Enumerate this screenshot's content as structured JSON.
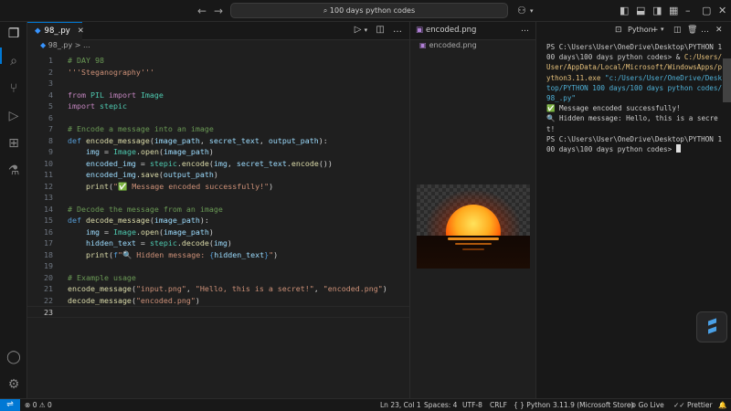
{
  "titlebar": {
    "search_text": "100 days python codes",
    "search_icon": "search-icon"
  },
  "editor": {
    "tab_label": "98_.py",
    "breadcrumb": "98_.py > ...",
    "lines": [
      {
        "n": "1",
        "segs": [
          [
            "cm",
            "# DAY 98"
          ]
        ]
      },
      {
        "n": "2",
        "segs": [
          [
            "st",
            "'''Steganography'''"
          ]
        ]
      },
      {
        "n": "3",
        "segs": []
      },
      {
        "n": "4",
        "segs": [
          [
            "kw",
            "from "
          ],
          [
            "ty",
            "PIL "
          ],
          [
            "kw",
            "import "
          ],
          [
            "ty",
            "Image"
          ]
        ]
      },
      {
        "n": "5",
        "segs": [
          [
            "kw",
            "import "
          ],
          [
            "ty",
            "stepic"
          ]
        ]
      },
      {
        "n": "6",
        "segs": []
      },
      {
        "n": "7",
        "segs": [
          [
            "cm",
            "# Encode a message into an image"
          ]
        ]
      },
      {
        "n": "8",
        "segs": [
          [
            "dk",
            "def "
          ],
          [
            "fn",
            "encode_message"
          ],
          [
            "pl",
            "("
          ],
          [
            "va",
            "image_path"
          ],
          [
            "pl",
            ", "
          ],
          [
            "va",
            "secret_text"
          ],
          [
            "pl",
            ", "
          ],
          [
            "va",
            "output_path"
          ],
          [
            "pl",
            "):"
          ]
        ]
      },
      {
        "n": "9",
        "segs": [
          [
            "pl",
            "    "
          ],
          [
            "va",
            "img"
          ],
          [
            "pl",
            " = "
          ],
          [
            "ty",
            "Image"
          ],
          [
            "pl",
            "."
          ],
          [
            "fn",
            "open"
          ],
          [
            "pl",
            "("
          ],
          [
            "va",
            "image_path"
          ],
          [
            "pl",
            ")"
          ]
        ]
      },
      {
        "n": "10",
        "segs": [
          [
            "pl",
            "    "
          ],
          [
            "va",
            "encoded_img"
          ],
          [
            "pl",
            " = "
          ],
          [
            "ty",
            "stepic"
          ],
          [
            "pl",
            "."
          ],
          [
            "fn",
            "encode"
          ],
          [
            "pl",
            "("
          ],
          [
            "va",
            "img"
          ],
          [
            "pl",
            ", "
          ],
          [
            "va",
            "secret_text"
          ],
          [
            "pl",
            "."
          ],
          [
            "fn",
            "encode"
          ],
          [
            "pl",
            "())"
          ]
        ]
      },
      {
        "n": "11",
        "segs": [
          [
            "pl",
            "    "
          ],
          [
            "va",
            "encoded_img"
          ],
          [
            "pl",
            "."
          ],
          [
            "fn",
            "save"
          ],
          [
            "pl",
            "("
          ],
          [
            "va",
            "output_path"
          ],
          [
            "pl",
            ")"
          ]
        ]
      },
      {
        "n": "12",
        "segs": [
          [
            "pl",
            "    "
          ],
          [
            "fn",
            "print"
          ],
          [
            "pl",
            "("
          ],
          [
            "st",
            "\""
          ],
          [
            "ck",
            "✅"
          ],
          [
            "st",
            " Message encoded successfully!\""
          ],
          [
            "pl",
            ")"
          ]
        ]
      },
      {
        "n": "13",
        "segs": []
      },
      {
        "n": "14",
        "segs": [
          [
            "cm",
            "# Decode the message from an image"
          ]
        ]
      },
      {
        "n": "15",
        "segs": [
          [
            "dk",
            "def "
          ],
          [
            "fn",
            "decode_message"
          ],
          [
            "pl",
            "("
          ],
          [
            "va",
            "image_path"
          ],
          [
            "pl",
            "):"
          ]
        ]
      },
      {
        "n": "16",
        "segs": [
          [
            "pl",
            "    "
          ],
          [
            "va",
            "img"
          ],
          [
            "pl",
            " = "
          ],
          [
            "ty",
            "Image"
          ],
          [
            "pl",
            "."
          ],
          [
            "fn",
            "open"
          ],
          [
            "pl",
            "("
          ],
          [
            "va",
            "image_path"
          ],
          [
            "pl",
            ")"
          ]
        ]
      },
      {
        "n": "17",
        "segs": [
          [
            "pl",
            "    "
          ],
          [
            "va",
            "hidden_text"
          ],
          [
            "pl",
            " = "
          ],
          [
            "ty",
            "stepic"
          ],
          [
            "pl",
            "."
          ],
          [
            "fn",
            "decode"
          ],
          [
            "pl",
            "("
          ],
          [
            "va",
            "img"
          ],
          [
            "pl",
            ")"
          ]
        ]
      },
      {
        "n": "18",
        "segs": [
          [
            "pl",
            "    "
          ],
          [
            "fn",
            "print"
          ],
          [
            "pl",
            "("
          ],
          [
            "dk",
            "f"
          ],
          [
            "st",
            "\"🔍 Hidden message: "
          ],
          [
            "dk",
            "{"
          ],
          [
            "va",
            "hidden_text"
          ],
          [
            "dk",
            "}"
          ],
          [
            "st",
            "\""
          ],
          [
            "pl",
            ")"
          ]
        ]
      },
      {
        "n": "19",
        "segs": []
      },
      {
        "n": "20",
        "segs": [
          [
            "cm",
            "# Example usage"
          ]
        ]
      },
      {
        "n": "21",
        "segs": [
          [
            "fn",
            "encode_message"
          ],
          [
            "pl",
            "("
          ],
          [
            "st",
            "\"input.png\""
          ],
          [
            "pl",
            ", "
          ],
          [
            "st",
            "\"Hello, this is a secret!\""
          ],
          [
            "pl",
            ", "
          ],
          [
            "st",
            "\"encoded.png\""
          ],
          [
            "pl",
            ")"
          ]
        ]
      },
      {
        "n": "22",
        "segs": [
          [
            "fn",
            "decode_message"
          ],
          [
            "pl",
            "("
          ],
          [
            "st",
            "\"encoded.png\""
          ],
          [
            "pl",
            ")"
          ]
        ]
      },
      {
        "n": "23",
        "segs": []
      }
    ]
  },
  "image_preview": {
    "tab_label": "encoded.png",
    "breadcrumb": "encoded.png"
  },
  "terminal": {
    "shell_label": "Python",
    "output": [
      {
        "cls": "",
        "text": "PS C:\\Users\\User\\OneDrive\\Desktop\\PYTHON 100 days\\100 days python codes> & "
      },
      {
        "cls": "tyellow",
        "text": "C:/Users/User/AppData/Local/Microsoft/WindowsApps/python3.11.exe "
      },
      {
        "cls": "tstr",
        "text": "\"c:/Users/User/OneDrive/Desktop/PYTHON 100 days/100 days python codes/98_.py\""
      },
      {
        "cls": "",
        "text": "\n✅ Message encoded successfully!\n🔍 Hidden message: Hello, this is a secret!\nPS C:\\Users\\User\\OneDrive\\Desktop\\PYTHON 100 days\\100 days python codes> "
      }
    ]
  },
  "statusbar": {
    "errors": "0",
    "warnings": "0",
    "position": "Ln 23, Col 1",
    "spaces": "Spaces: 4",
    "encoding": "UTF-8",
    "eol": "CRLF",
    "language": "{ } Python",
    "interpreter": "3.11.9 (Microsoft Store)",
    "golive": "Go Live",
    "prettier": "Prettier"
  }
}
